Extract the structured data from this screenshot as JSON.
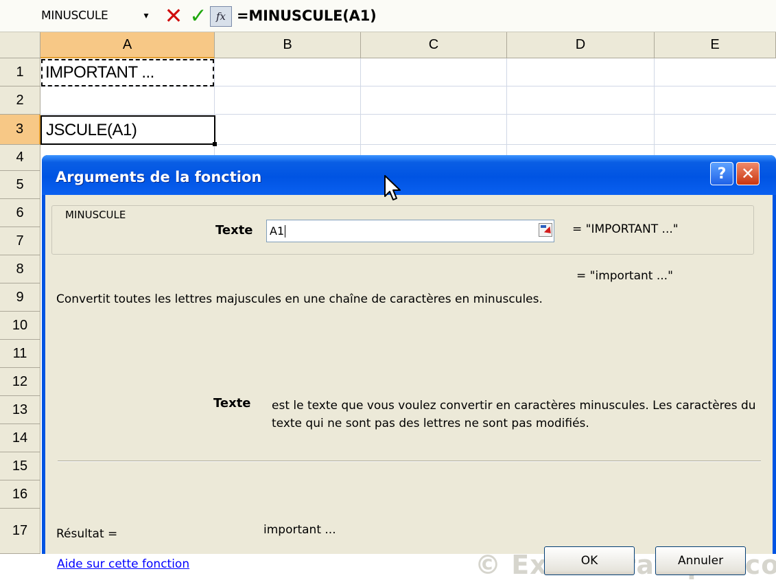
{
  "formula_bar": {
    "name_box": "MINUSCULE",
    "dropdown_glyph": "▾",
    "cancel_glyph": "✕",
    "enter_glyph": "✓",
    "fx_label": "fx",
    "formula": "=MINUSCULE(A1)"
  },
  "sheet": {
    "columns": [
      "A",
      "B",
      "C",
      "D",
      "E"
    ],
    "rows": [
      "1",
      "2",
      "3",
      "4",
      "5",
      "6",
      "7",
      "8",
      "9",
      "10",
      "11",
      "12",
      "13",
      "14",
      "15",
      "16",
      "17"
    ],
    "cells": {
      "A1": "IMPORTANT ...",
      "A3": "JSCULE(A1)"
    }
  },
  "dialog": {
    "title": "Arguments de la fonction",
    "help_glyph": "?",
    "close_glyph": "✕",
    "group_label": "MINUSCULE",
    "argument": {
      "label": "Texte",
      "value": "A1",
      "evaluated": "= \"IMPORTANT ...\""
    },
    "result_preview": "= \"important ...\"",
    "description": "Convertit toutes les lettres majuscules en une chaîne de caractères en minuscules.",
    "parameter": {
      "name": "Texte",
      "description": "est le texte que vous voulez convertir en caractères minuscules. Les caractères du texte qui ne sont pas des lettres ne sont pas modifiés."
    },
    "result_label": "Résultat =",
    "result_value": "important ...",
    "help_link": "Aide sur cette fonction",
    "ok_label": "OK",
    "cancel_label": "Annuler",
    "watermark": "© Excel-Pratique.com"
  },
  "colors": {
    "title_bar": "#0054e3",
    "dialog_face": "#ece9d8",
    "active_header": "#f7c886",
    "link": "#0000ff"
  }
}
